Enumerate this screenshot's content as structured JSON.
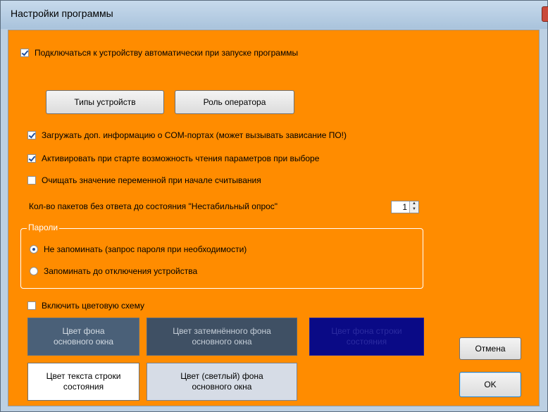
{
  "window": {
    "title": "Настройки программы"
  },
  "checkboxes": {
    "auto_connect": {
      "label": "Подключаться к устройству автоматически при запуске программы",
      "checked": true
    },
    "load_com_info": {
      "label": "Загружать доп. информацию о COM-портах (может вызывать зависание ПО!)",
      "checked": true
    },
    "activate_read": {
      "label": "Активировать при старте возможность чтения параметров при выборе",
      "checked": true
    },
    "clear_var": {
      "label": "Очищать значение переменной при начале считывания",
      "checked": false
    },
    "color_scheme": {
      "label": "Включить цветовую схему",
      "checked": false
    }
  },
  "buttons": {
    "device_types": "Типы устройств",
    "operator_role": "Роль оператора",
    "cancel": "Отмена",
    "ok": "OK"
  },
  "packets": {
    "label": "Кол-во пакетов без ответа до состояния \"Нестабильный опрос\"",
    "value": "1"
  },
  "passwords": {
    "legend": "Пароли",
    "option_no_remember": "Не запоминать (запрос пароля при необходимости)",
    "option_remember": "Запоминать до отключения устройства",
    "selected": "option_no_remember"
  },
  "color_buttons": {
    "main_bg": {
      "line1": "Цвет фона",
      "line2": "основного окна",
      "bg": "#4a6078",
      "fg": "#d3dbe3"
    },
    "dark_main_bg": {
      "line1": "Цвет затемнённого фона",
      "line2": "основного окна",
      "bg": "#3f5064",
      "fg": "#c5ced8"
    },
    "status_bg": {
      "line1": "Цвет фона строки",
      "line2": "состояния",
      "bg": "#0a0a86",
      "fg": "#2a2a9a"
    },
    "status_text": {
      "line1": "Цвет текста строки",
      "line2": "состояния",
      "bg": "#ffffff",
      "fg": "#000000"
    },
    "light_main_bg": {
      "line1": "Цвет (светлый) фона",
      "line2": "основного окна",
      "bg": "#d6dce6",
      "fg": "#000000"
    }
  },
  "colors": {
    "client_bg": "#ff8c00",
    "titlebar": "#bcd0e3"
  }
}
